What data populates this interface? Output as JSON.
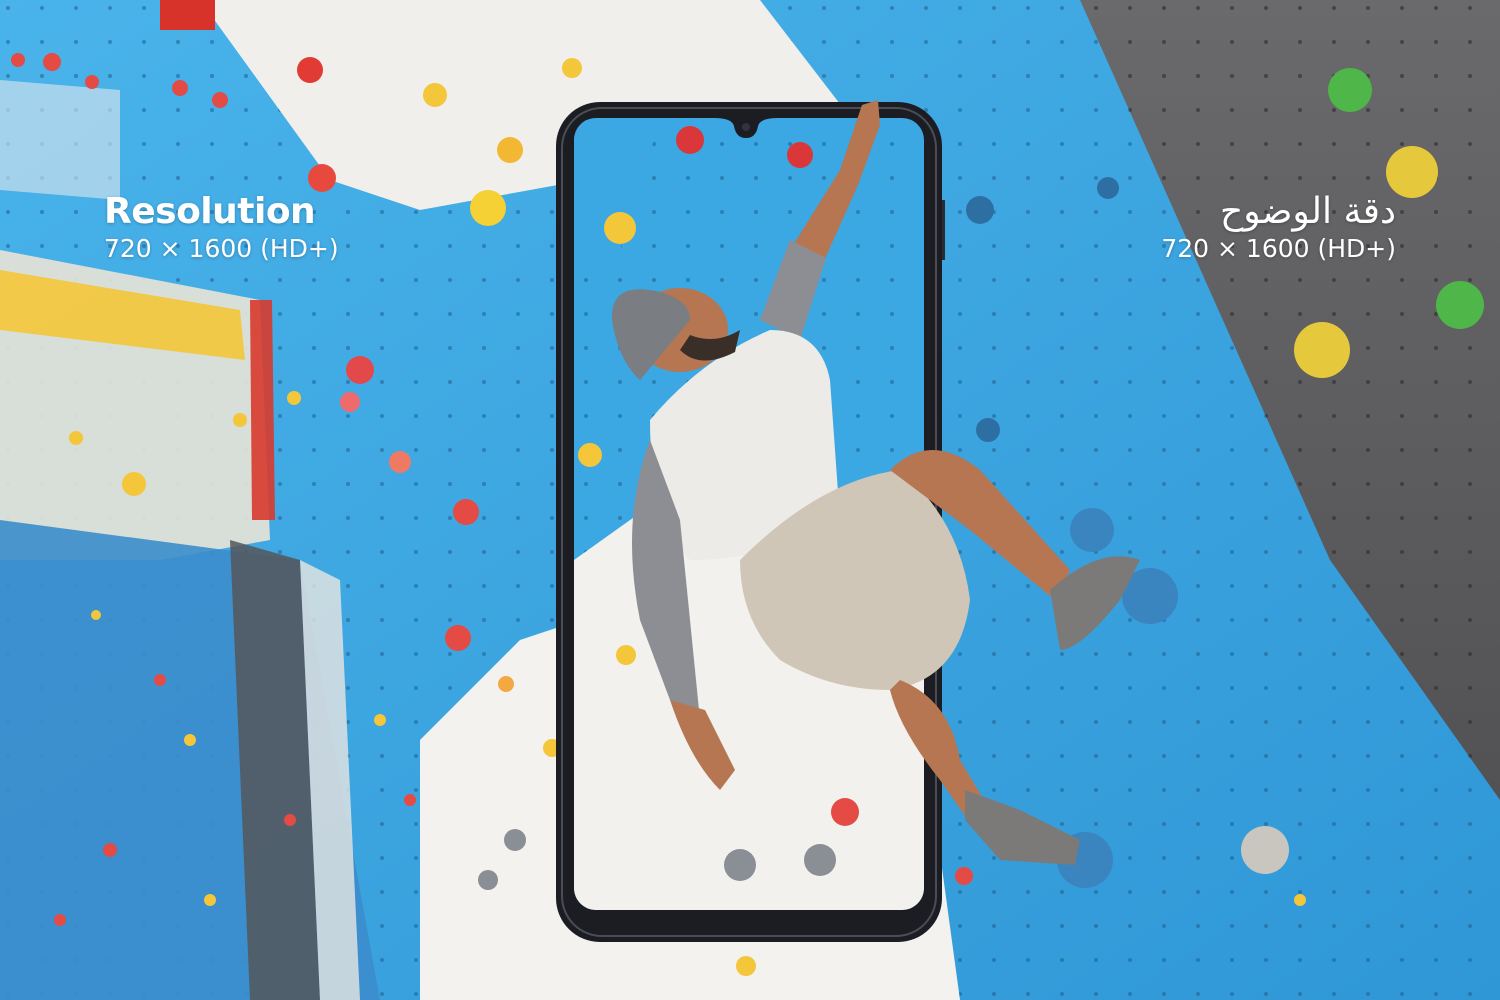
{
  "left_label": {
    "title": "Resolution",
    "spec": "720 × 1600 (HD+)"
  },
  "right_label": {
    "title": "دقة الوضوح",
    "spec": "720 × 1600 (HD+)"
  },
  "colors": {
    "wall_blue": "#3aa6e2",
    "wall_gray": "#5e5e60",
    "white_panel": "#f2f2ef",
    "phone_frame": "#1b1d22",
    "text": "#ffffff"
  },
  "icons": [
    "phone-frame",
    "front-camera-notch",
    "climber-figure",
    "climbing-hold"
  ]
}
